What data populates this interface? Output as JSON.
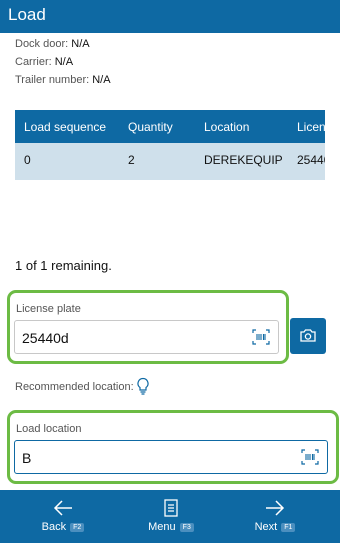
{
  "header": {
    "title": "Load"
  },
  "info": {
    "dock_door_label": "Dock door:",
    "dock_door_value": "N/A",
    "carrier_label": "Carrier:",
    "carrier_value": "N/A",
    "trailer_label": "Trailer number:",
    "trailer_value": "N/A"
  },
  "grid": {
    "columns": [
      "Load sequence",
      "Quantity",
      "Location",
      "Licen"
    ],
    "rows": [
      [
        "0",
        "2",
        "DEREKEQUIP",
        "25440"
      ]
    ]
  },
  "status": {
    "remaining": "1 of 1 remaining."
  },
  "license_plate": {
    "label": "License plate",
    "value": "25440d"
  },
  "recommended": {
    "label": "Recommended location:"
  },
  "load_location": {
    "label": "Load location",
    "value": "B"
  },
  "footer": {
    "back": {
      "label": "Back",
      "key": "F2"
    },
    "menu": {
      "label": "Menu",
      "key": "F3"
    },
    "next": {
      "label": "Next",
      "key": "F1"
    }
  },
  "colors": {
    "accent": "#0e69a3",
    "highlight": "#6cbb44",
    "row_selected": "#cfe0eb"
  }
}
